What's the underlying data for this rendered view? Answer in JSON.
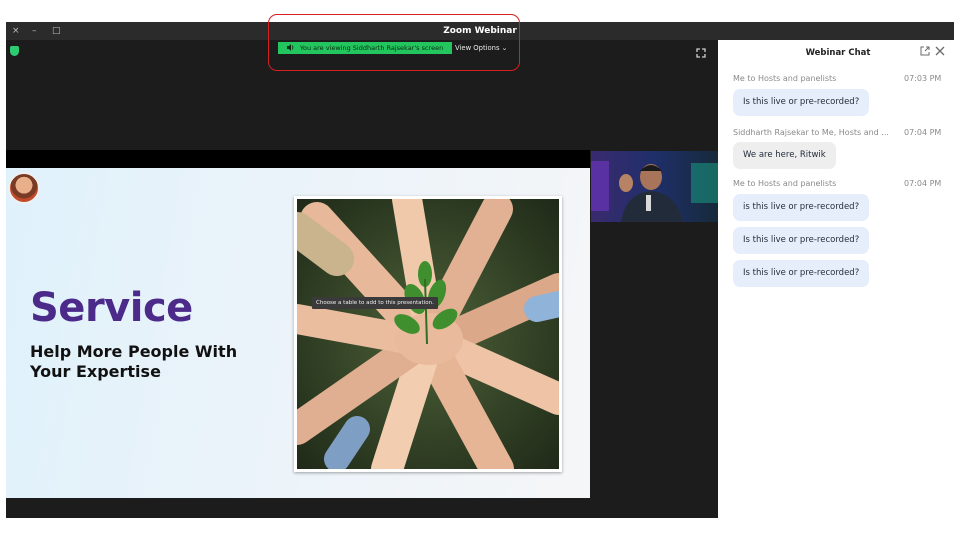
{
  "window": {
    "title": "Zoom Webinar",
    "controls": {
      "close": "×",
      "minimize": "–",
      "maximize": "□"
    }
  },
  "share": {
    "banner": "You are viewing Siddharth Rajsekar's screen",
    "view_options": "View Options ⌄"
  },
  "slide": {
    "title": "Service",
    "subtitle": "Help More People With Your Expertise",
    "tooltip": "Choose a table to add to this presentation."
  },
  "chat": {
    "title": "Webinar Chat",
    "messages": [
      {
        "meta": "Me to Hosts and panelists",
        "time": "07:03 PM",
        "bubbles": [
          "Is this live or pre-recorded?"
        ]
      },
      {
        "meta": "Siddharth Rajsekar to Me, Hosts and ...",
        "time": "07:04 PM",
        "bubbles": [
          "We are here, Ritwik"
        ]
      },
      {
        "meta": "Me to Hosts and panelists",
        "time": "07:04 PM",
        "bubbles": [
          "is this live or pre-recorded?",
          "Is this live or pre-recorded?",
          "Is this live or pre-recorded?"
        ]
      }
    ]
  },
  "colors": {
    "titlebar": "#2b2b2b",
    "share_banner": "#22c55e",
    "highlight": "#d61f1f",
    "slide_title": "#4b2a8a",
    "chat_bubble": "#e6eefb"
  },
  "icons": {
    "shield": "shield-icon",
    "fullscreen": "fullscreen-icon",
    "popout": "popout-icon",
    "close": "close-icon",
    "speaker": "speaker-icon",
    "chevron": "chevron-down-icon"
  }
}
